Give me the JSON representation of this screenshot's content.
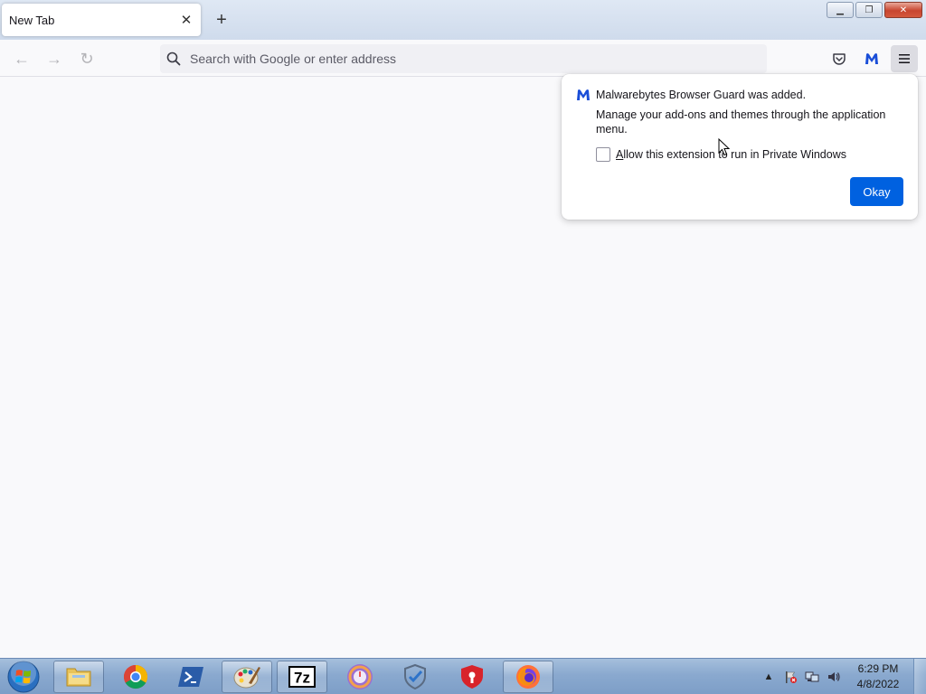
{
  "browser": {
    "tab": {
      "title": "New Tab",
      "close_label": "✕"
    },
    "new_tab_label": "+",
    "window_controls": {
      "minimize": "▁",
      "restore": "❐",
      "close": "✕"
    },
    "nav": {
      "back": "←",
      "forward": "→",
      "reload": "↻"
    },
    "urlbar": {
      "placeholder": "Search with Google or enter address"
    },
    "toolbar_icons": [
      "pocket-icon",
      "malwarebytes-icon",
      "hamburger-menu-icon"
    ]
  },
  "panel": {
    "title": "Malwarebytes Browser Guard was added.",
    "message": "Manage your add-ons and themes through the application menu.",
    "checkbox_label_accesskey": "A",
    "checkbox_label_rest": "llow this extension to run in Private Windows",
    "checkbox_checked": false,
    "okay_label": "Okay",
    "accent_color": "#0061e0"
  },
  "taskbar": {
    "apps": [
      "file-explorer",
      "chrome",
      "powershell",
      "paint",
      "7zip",
      "app-circle",
      "windows-defender",
      "shield-app",
      "firefox"
    ],
    "clock": {
      "time": "6:29 PM",
      "date": "4/8/2022"
    },
    "tray_arrow": "▲"
  }
}
